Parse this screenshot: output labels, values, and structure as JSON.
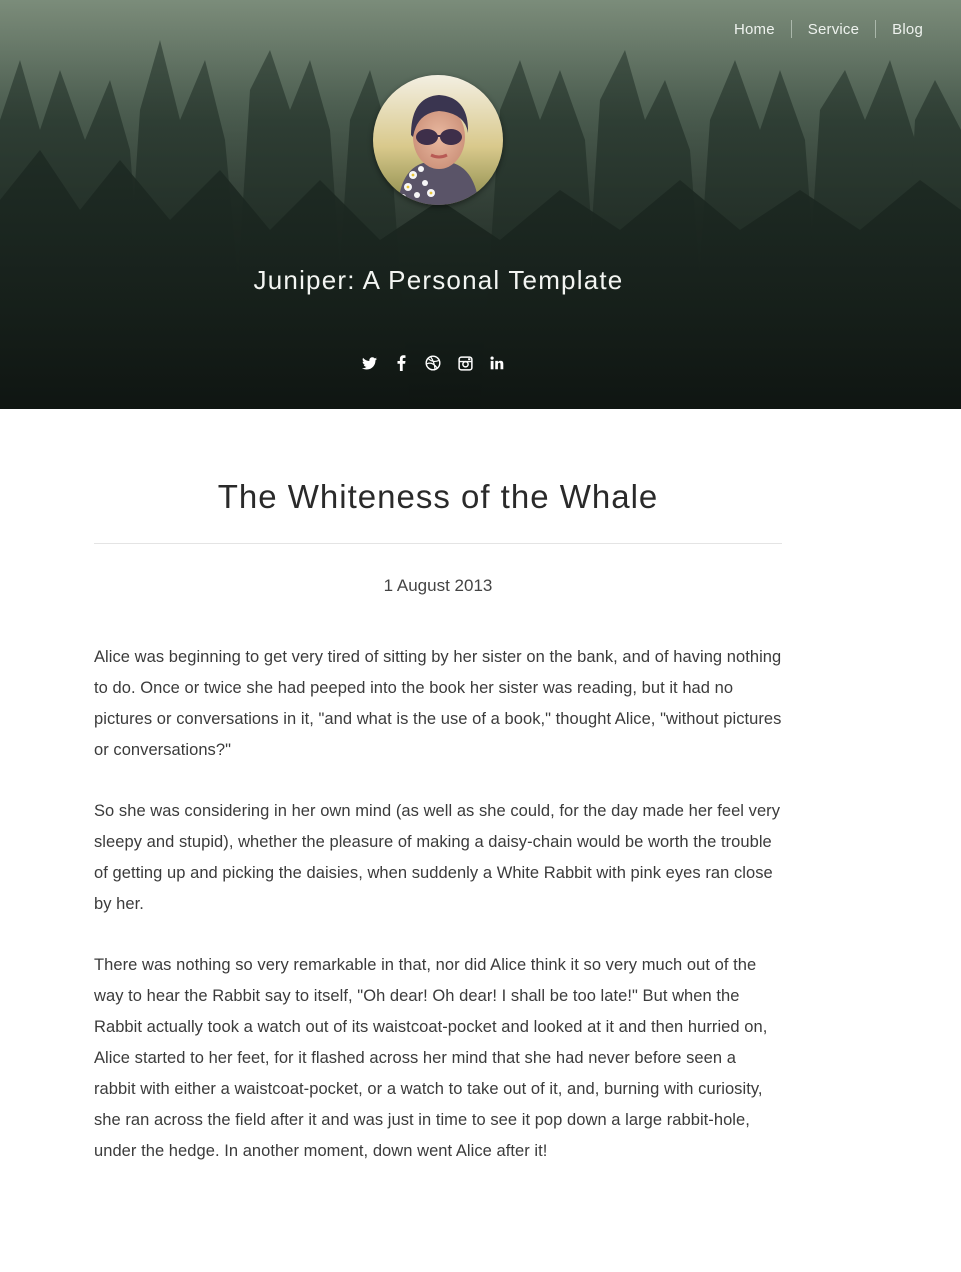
{
  "nav": {
    "items": [
      {
        "label": "Home"
      },
      {
        "label": "Service"
      },
      {
        "label": "Blog"
      }
    ]
  },
  "header": {
    "title": "Juniper: A Personal Template",
    "social": [
      {
        "icon": "twitter-icon"
      },
      {
        "icon": "facebook-icon"
      },
      {
        "icon": "dribbble-icon"
      },
      {
        "icon": "instagram-icon"
      },
      {
        "icon": "linkedin-icon"
      }
    ]
  },
  "post": {
    "title": "The Whiteness of the Whale",
    "date": "1 August 2013",
    "paragraphs": [
      "Alice was beginning to get very tired of sitting by her sister on the bank, and of having nothing to do. Once or twice she had peeped into the book her sister was reading, but it had no pictures or conversations in it, \"and what is the use of a book,\" thought Alice, \"without pictures or conversations?\"",
      "So she was considering in her own mind (as well as she could, for the day made her feel very sleepy and stupid), whether the pleasure of making a daisy-chain would be worth the trouble of getting up and picking the daisies, when suddenly a White Rabbit with pink eyes ran close by her.",
      "There was nothing so very remarkable in that, nor did Alice think it so very much out of the way to hear the Rabbit say to itself, \"Oh dear! Oh dear! I shall be too late!\" But when the Rabbit actually took a watch out of its waistcoat-pocket and looked at it and then hurried on, Alice started to her feet, for it flashed across her mind that she had never before seen a rabbit with either a waistcoat-pocket, or a watch to take out of it, and, burning with curiosity, she ran across the field after it and was just in time to see it pop down a large rabbit-hole, under the hedge. In another moment, down went Alice after it!"
    ]
  },
  "colors": {
    "hero_top": "#6e7f6f",
    "hero_bottom": "#141b18",
    "text": "#3b3b3b",
    "title": "#2a2a2a"
  }
}
